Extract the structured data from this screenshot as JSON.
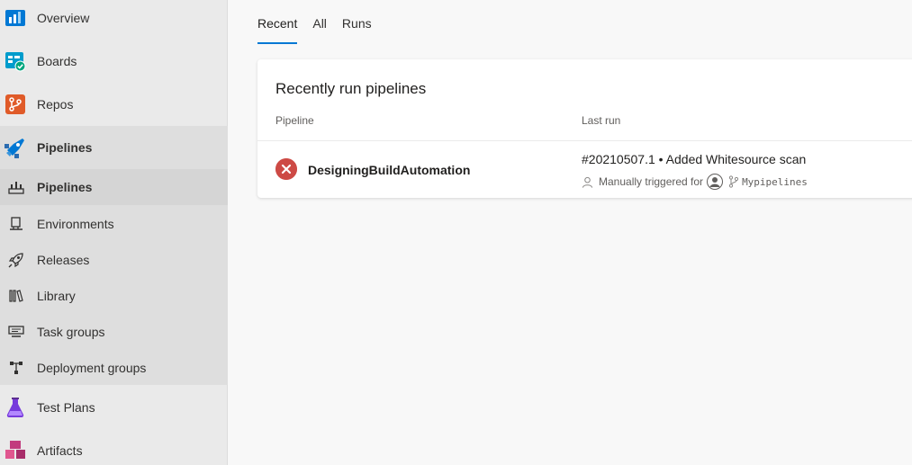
{
  "sidebar": {
    "items": [
      {
        "label": "Overview",
        "icon": "overview-icon"
      },
      {
        "label": "Boards",
        "icon": "boards-icon"
      },
      {
        "label": "Repos",
        "icon": "repos-icon"
      },
      {
        "label": "Pipelines",
        "icon": "pipelines-icon"
      },
      {
        "label": "Pipelines",
        "icon": "pipelines-sub-icon"
      },
      {
        "label": "Environments",
        "icon": "environments-icon"
      },
      {
        "label": "Releases",
        "icon": "rocket-icon"
      },
      {
        "label": "Library",
        "icon": "library-icon"
      },
      {
        "label": "Task groups",
        "icon": "task-groups-icon"
      },
      {
        "label": "Deployment groups",
        "icon": "deployment-groups-icon"
      },
      {
        "label": "Test Plans",
        "icon": "test-plans-icon"
      },
      {
        "label": "Artifacts",
        "icon": "artifacts-icon"
      }
    ]
  },
  "tabs": [
    "Recent",
    "All",
    "Runs"
  ],
  "card": {
    "title": "Recently run pipelines",
    "columns": [
      "Pipeline",
      "Last run"
    ],
    "rows": [
      {
        "status": "failed",
        "name": "DesigningBuildAutomation",
        "run": "#20210507.1 • Added Whitesource scan",
        "trigger": "Manually triggered for",
        "branch": "Mypipelines"
      }
    ]
  },
  "colors": {
    "accent": "#0078d4",
    "failed": "#cd4a45",
    "pipelines": "#0078d4",
    "repos": "#e05b29",
    "boards": "#009ccc",
    "test_plans": "#773adc",
    "artifacts": "#c23b7e"
  }
}
